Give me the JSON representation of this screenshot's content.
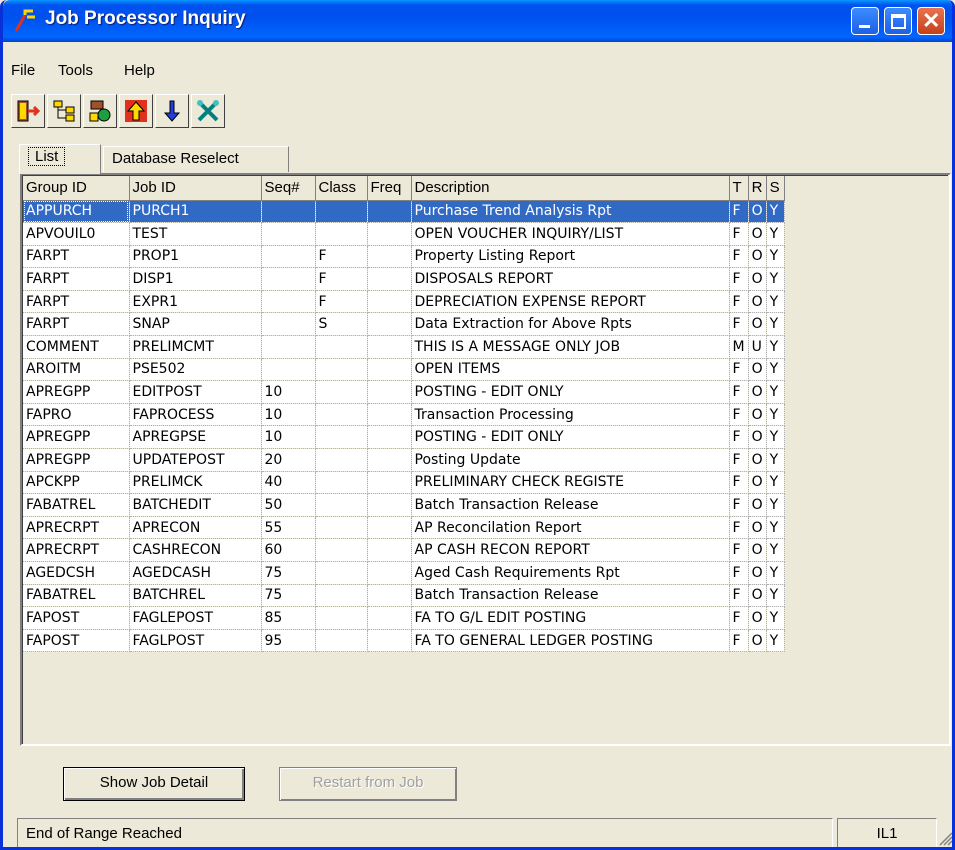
{
  "window": {
    "title": "Job Processor Inquiry"
  },
  "menu": [
    "File",
    "Tools",
    "Help"
  ],
  "toolbar": {
    "icons": [
      "exit-icon",
      "tree-icon",
      "jobs-icon",
      "move-up-icon",
      "move-down-icon",
      "tools-icon"
    ]
  },
  "tabs": {
    "list": "List",
    "reselect": "Database Reselect"
  },
  "table": {
    "columns": [
      "Group ID",
      "Job ID",
      "Seq#",
      "Class",
      "Freq",
      "Description",
      "T",
      "R",
      "S"
    ],
    "rows": [
      [
        "APPURCH",
        "PURCH1",
        "",
        "",
        "",
        "Purchase Trend Analysis Rpt",
        "F",
        "O",
        "Y"
      ],
      [
        "APVOUIL0",
        "TEST",
        "",
        "",
        "",
        "OPEN VOUCHER INQUIRY/LIST",
        "F",
        "O",
        "Y"
      ],
      [
        "FARPT",
        "PROP1",
        "",
        "F",
        "",
        "Property Listing Report",
        "F",
        "O",
        "Y"
      ],
      [
        "FARPT",
        "DISP1",
        "",
        "F",
        "",
        "DISPOSALS REPORT",
        "F",
        "O",
        "Y"
      ],
      [
        "FARPT",
        "EXPR1",
        "",
        "F",
        "",
        "DEPRECIATION EXPENSE REPORT",
        "F",
        "O",
        "Y"
      ],
      [
        "FARPT",
        "SNAP",
        "",
        "S",
        "",
        "Data Extraction for Above Rpts",
        "F",
        "O",
        "Y"
      ],
      [
        "COMMENT",
        "PRELIMCMT",
        "",
        "",
        "",
        "THIS IS A MESSAGE ONLY JOB",
        "M",
        "U",
        "Y"
      ],
      [
        "AROITM",
        "PSE502",
        "",
        "",
        "",
        "OPEN ITEMS",
        "F",
        "O",
        "Y"
      ],
      [
        "APREGPP",
        "EDITPOST",
        "10",
        "",
        "",
        "POSTING - EDIT ONLY",
        "F",
        "O",
        "Y"
      ],
      [
        "FAPRO",
        "FAPROCESS",
        "10",
        "",
        "",
        "Transaction Processing",
        "F",
        "O",
        "Y"
      ],
      [
        "APREGPP",
        "APREGPSE",
        "10",
        "",
        "",
        "POSTING - EDIT ONLY",
        "F",
        "O",
        "Y"
      ],
      [
        "APREGPP",
        "UPDATEPOST",
        "20",
        "",
        "",
        "Posting Update",
        "F",
        "O",
        "Y"
      ],
      [
        "APCKPP",
        "PRELIMCK",
        "40",
        "",
        "",
        "PRELIMINARY CHECK REGISTE",
        "F",
        "O",
        "Y"
      ],
      [
        "FABATREL",
        "BATCHEDIT",
        "50",
        "",
        "",
        "Batch Transaction Release",
        "F",
        "O",
        "Y"
      ],
      [
        "APRECRPT",
        "APRECON",
        "55",
        "",
        "",
        "AP Reconcilation Report",
        "F",
        "O",
        "Y"
      ],
      [
        "APRECRPT",
        "CASHRECON",
        "60",
        "",
        "",
        "AP CASH RECON REPORT",
        "F",
        "O",
        "Y"
      ],
      [
        "AGEDCSH",
        "AGEDCASH",
        "75",
        "",
        "",
        "Aged Cash Requirements Rpt",
        "F",
        "O",
        "Y"
      ],
      [
        "FABATREL",
        "BATCHREL",
        "75",
        "",
        "",
        "Batch Transaction Release",
        "F",
        "O",
        "Y"
      ],
      [
        "FAPOST",
        "FAGLEPOST",
        "85",
        "",
        "",
        "FA TO G/L EDIT POSTING",
        "F",
        "O",
        "Y"
      ],
      [
        "FAPOST",
        "FAGLPOST",
        "95",
        "",
        "",
        "FA TO GENERAL LEDGER POSTING",
        "F",
        "O",
        "Y"
      ]
    ],
    "selected_row": 0
  },
  "buttons": {
    "detail": "Show Job Detail",
    "restart": "Restart from Job"
  },
  "status": {
    "message": "End of Range Reached",
    "code": "IL1"
  }
}
